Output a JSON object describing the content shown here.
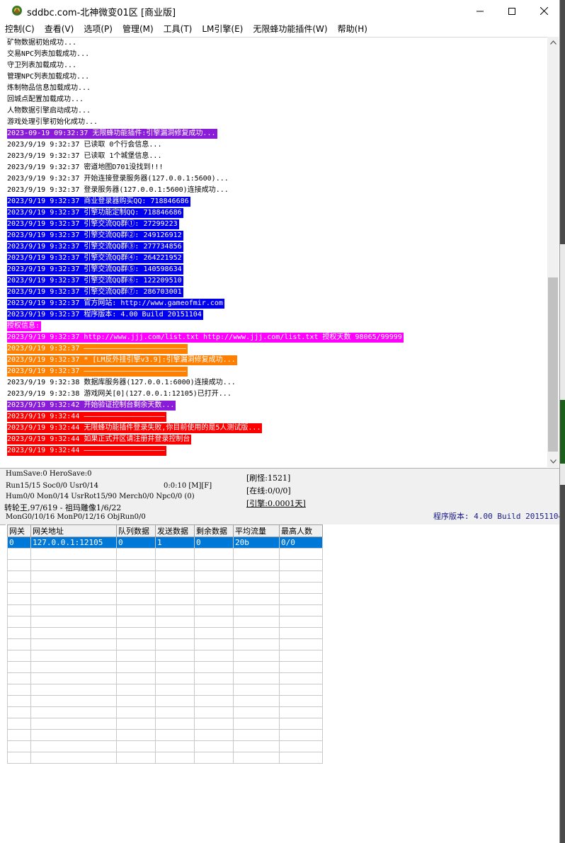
{
  "window": {
    "title": "sddbc.com-北神微变01区 [商业版]",
    "minimize_glyph": "─",
    "maximize_glyph": "☐",
    "close_glyph": "✕"
  },
  "menu": [
    "控制(C)",
    "查看(V)",
    "选项(P)",
    "管理(M)",
    "工具(T)",
    "LM引擎(E)",
    "无限蜂功能插件(W)",
    "帮助(H)"
  ],
  "colors": {
    "purple": "#8a1bd8",
    "blue": "#0000ee",
    "magenta": "#ff00ff",
    "orange": "#ff7f00",
    "red": "#ff0000",
    "selection": "#0078d7"
  },
  "log": [
    {
      "text": "矿物数据初始成功...",
      "bg": "",
      "fg": "#000000"
    },
    {
      "text": "交易NPC列表加载成功...",
      "bg": "",
      "fg": "#000000"
    },
    {
      "text": "守卫列表加载成功...",
      "bg": "",
      "fg": "#000000"
    },
    {
      "text": "管理NPC列表加载成功...",
      "bg": "",
      "fg": "#000000"
    },
    {
      "text": "炼制物品信息加载成功...",
      "bg": "",
      "fg": "#000000"
    },
    {
      "text": "回城点配置加载成功...",
      "bg": "",
      "fg": "#000000"
    },
    {
      "text": "人物数据引擎启动成功...",
      "bg": "",
      "fg": "#000000"
    },
    {
      "text": "游戏处理引擎初始化成功...",
      "bg": "",
      "fg": "#000000"
    },
    {
      "text": "2023-09-19 09:32:37 无限蜂功能插件:引擎漏洞修复成功...",
      "bg": "#8a1bd8",
      "fg": "#ffffff"
    },
    {
      "text": "2023/9/19 9:32:37 已读取 0个行会信息...",
      "bg": "",
      "fg": "#000000"
    },
    {
      "text": "2023/9/19 9:32:37 已读取 1个城堡信息...",
      "bg": "",
      "fg": "#000000"
    },
    {
      "text": "2023/9/19 9:32:37 密道地图D701没找到!!!",
      "bg": "",
      "fg": "#000000"
    },
    {
      "text": "2023/9/19 9:32:37 开始连接登录服务器(127.0.0.1:5600)...",
      "bg": "",
      "fg": "#000000"
    },
    {
      "text": "2023/9/19 9:32:37 登录服务器(127.0.0.1:5600)连接成功...",
      "bg": "",
      "fg": "#000000"
    },
    {
      "text": "2023/9/19 9:32:37 商业登录器购买QQ: 718846686",
      "bg": "#0000ee",
      "fg": "#ffffff"
    },
    {
      "text": "2023/9/19 9:32:37 引擎功能定制QQ: 718846686",
      "bg": "#0000ee",
      "fg": "#ffffff"
    },
    {
      "text": "2023/9/19 9:32:37 引擎交流QQ群①: 27299223",
      "bg": "#0000ee",
      "fg": "#ffffff"
    },
    {
      "text": "2023/9/19 9:32:37 引擎交流QQ群②: 249126912",
      "bg": "#0000ee",
      "fg": "#ffffff"
    },
    {
      "text": "2023/9/19 9:32:37 引擎交流QQ群③: 277734856",
      "bg": "#0000ee",
      "fg": "#ffffff"
    },
    {
      "text": "2023/9/19 9:32:37 引擎交流QQ群④: 264221952",
      "bg": "#0000ee",
      "fg": "#ffffff"
    },
    {
      "text": "2023/9/19 9:32:37 引擎交流QQ群⑤: 140598634",
      "bg": "#0000ee",
      "fg": "#ffffff"
    },
    {
      "text": "2023/9/19 9:32:37 引擎交流QQ群⑥: 122209510",
      "bg": "#0000ee",
      "fg": "#ffffff"
    },
    {
      "text": "2023/9/19 9:32:37 引擎交流QQ群⑦: 286703001",
      "bg": "#0000ee",
      "fg": "#ffffff"
    },
    {
      "text": "2023/9/19 9:32:37 官方网站: http://www.gameofmir.com",
      "bg": "#0000ee",
      "fg": "#ffffff"
    },
    {
      "text": "2023/9/19 9:32:37 程序版本: 4.00 Build 20151104",
      "bg": "#0000ee",
      "fg": "#ffffff"
    },
    {
      "text": "授权信息:",
      "bg": "#ff00ff",
      "fg": "#ffffff"
    },
    {
      "text": "2023/9/19 9:32:37 http://www.jjj.com/list.txt http://www.jjj.com/list.txt 授权天数 98065/99999",
      "bg": "#ff00ff",
      "fg": "#ffffff"
    },
    {
      "text": "2023/9/19 9:32:37 ————————————————————————",
      "bg": "#ff7f00",
      "fg": "#ffffff"
    },
    {
      "text": "2023/9/19 9:32:37 * [LM反外挂引擎v3.9]:引擎漏洞修复成功...",
      "bg": "#ff7f00",
      "fg": "#ffffff"
    },
    {
      "text": "2023/9/19 9:32:37 ————————————————————————",
      "bg": "#ff7f00",
      "fg": "#ffffff"
    },
    {
      "text": "2023/9/19 9:32:38 数据库服务器(127.0.0.1:6000)连接成功...",
      "bg": "",
      "fg": "#000000"
    },
    {
      "text": "2023/9/19 9:32:38 游戏网关[0](127.0.0.1:12105)已打开...",
      "bg": "",
      "fg": "#000000"
    },
    {
      "text": "2023/9/19 9:32:42 开始验证控制台剩余天数...",
      "bg": "#8a1bd8",
      "fg": "#ffffff"
    },
    {
      "text": "2023/9/19 9:32:44 ———————————————————",
      "bg": "#ff0000",
      "fg": "#ffffff"
    },
    {
      "text": "2023/9/19 9:32:44 无限蜂功能插件登录失败,你目前使用的是5人测试版...",
      "bg": "#ff0000",
      "fg": "#ffffff"
    },
    {
      "text": "2023/9/19 9:32:44 如果正式开区请注册并登录控制台",
      "bg": "#ff0000",
      "fg": "#ffffff"
    },
    {
      "text": "2023/9/19 9:32:44 ———————————————————",
      "bg": "#ff0000",
      "fg": "#ffffff"
    }
  ],
  "status": {
    "line1": "HumSave:0 HeroSave:0",
    "line2": "Run15/15 Soc0/0 Usr0/14",
    "line2b": "0:0:10 [M][F]",
    "line3": "Hum0/0 Mon0/14 UsrRot15/90 Merch0/0 Npc0/0 (0)",
    "line4": "转轮王,97/619 - 祖玛雕像1/6/22",
    "line5": "MonG0/10/16 MonP0/12/16 ObjRun0/0",
    "refresh": "[刷怪:1521]",
    "online": "[在线:0/0/0]",
    "engine": "[引擎:0.0001天]",
    "version": "程序版本: 4.00 Build 20151104"
  },
  "grid": {
    "headers": [
      "网关",
      "网关地址",
      "队列数据",
      "发送数据",
      "剩余数据",
      "平均流量",
      "最高人数"
    ],
    "rows": [
      [
        "0",
        "127.0.0.1:12105",
        "0",
        "1",
        "0",
        "20b",
        "0/0"
      ]
    ]
  }
}
